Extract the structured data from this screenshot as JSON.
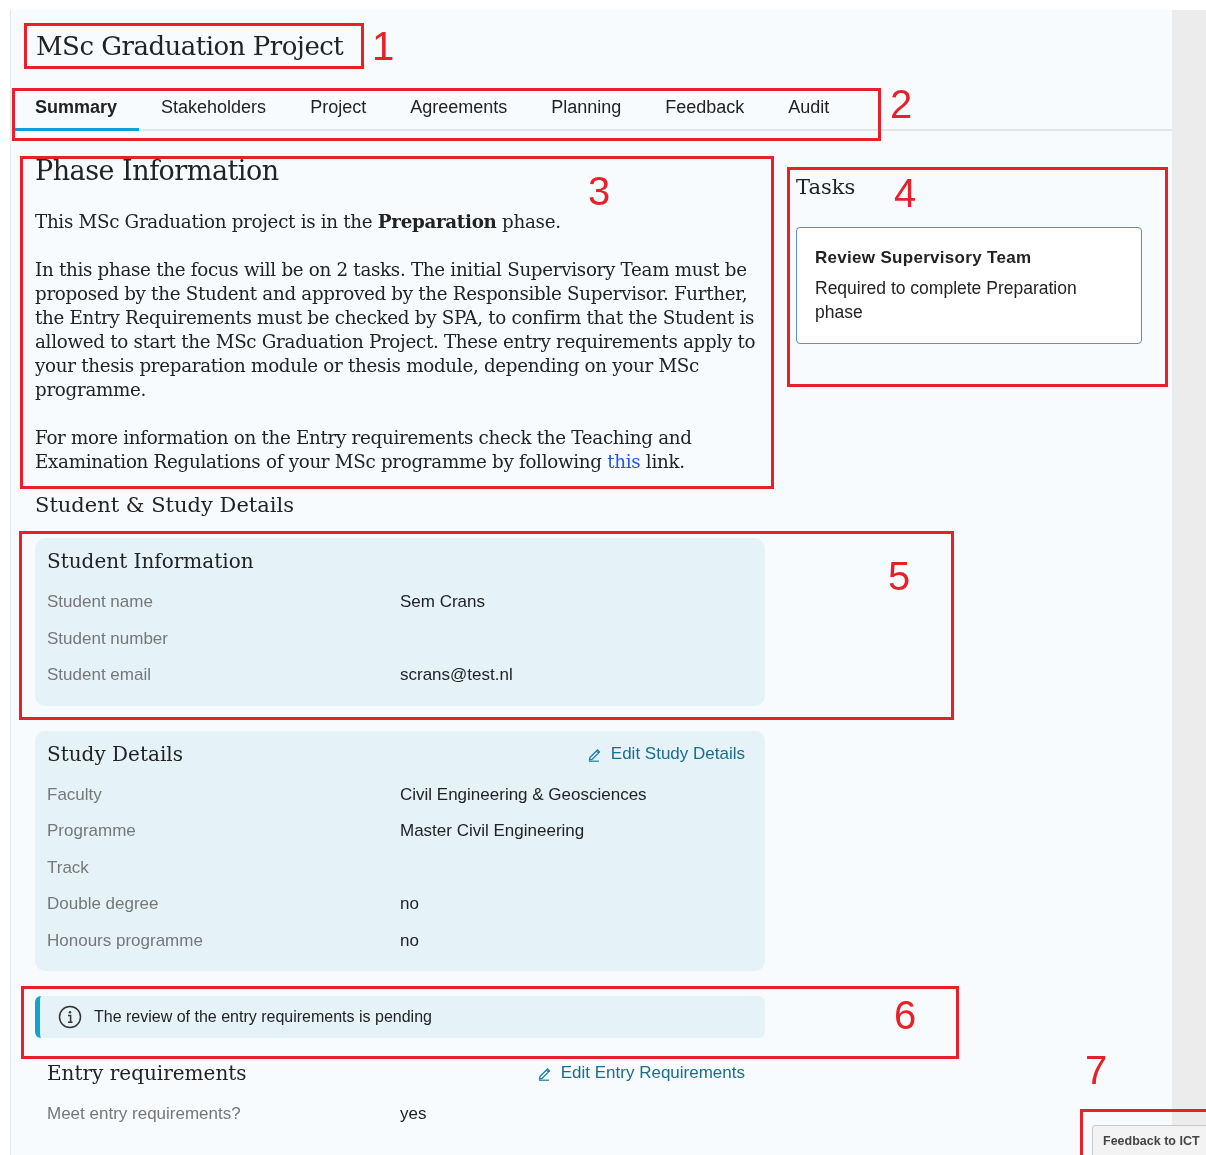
{
  "title": "MSc Graduation Project",
  "tabs": [
    {
      "label": "Summary",
      "selected": true
    },
    {
      "label": "Stakeholders",
      "selected": false
    },
    {
      "label": "Project",
      "selected": false
    },
    {
      "label": "Agreements",
      "selected": false
    },
    {
      "label": "Planning",
      "selected": false
    },
    {
      "label": "Feedback",
      "selected": false
    },
    {
      "label": "Audit",
      "selected": false
    }
  ],
  "phase": {
    "heading": "Phase Information",
    "paragraphs": [
      {
        "text": "This MSc Graduation project is in the **Preparation** phase."
      },
      {
        "text": "In this phase the focus will be on 2 tasks. The initial Supervisory Team must be proposed by the Student and approved by the Responsible Supervisor. Further, the Entry Requirements must be checked by SPA, to confirm that the Student is allowed to start the MSc Graduation Project. These entry requirements apply to your thesis preparation module or thesis module, depending on your MSc programme."
      },
      {
        "text": "For more information on the Entry requirements check the Teaching and Examination Regulations of your MSc programme by following ",
        "link": "this",
        "after": " link."
      }
    ]
  },
  "tasks": {
    "heading": "Tasks",
    "items": [
      {
        "title": "Review Supervisory Team",
        "subtitle": "Required to complete Preparation phase"
      }
    ]
  },
  "details_heading": "Student & Study Details",
  "student_card": {
    "heading": "Student Information",
    "rows": [
      {
        "label": "Student name",
        "value": "Sem Crans"
      },
      {
        "label": "Student number"
      },
      {
        "label": "Student email",
        "value": "scrans@test.nl"
      }
    ]
  },
  "study_card": {
    "heading": "Study Details",
    "edit_link": "Edit Study Details",
    "rows": [
      {
        "label": "Faculty",
        "value": "Civil Engineering & Geosciences"
      },
      {
        "label": "Programme",
        "value": "Master Civil Engineering"
      },
      {
        "label": "Track"
      },
      {
        "label": "Double degree",
        "value": "no"
      },
      {
        "label": "Honours programme",
        "value": "no"
      }
    ]
  },
  "notice": "The review of the entry requirements is pending",
  "entry": {
    "heading": "Entry requirements",
    "edit_link": "Edit Entry Requirements",
    "rows": [
      {
        "label": "Meet entry requirements?",
        "value": "yes"
      }
    ]
  },
  "feedback_button": "Feedback to ICT",
  "callouts": [
    {
      "number": "1"
    },
    {
      "number": "2"
    },
    {
      "number": "3"
    },
    {
      "number": "4"
    },
    {
      "number": "5"
    },
    {
      "number": "6"
    },
    {
      "number": "7"
    }
  ]
}
